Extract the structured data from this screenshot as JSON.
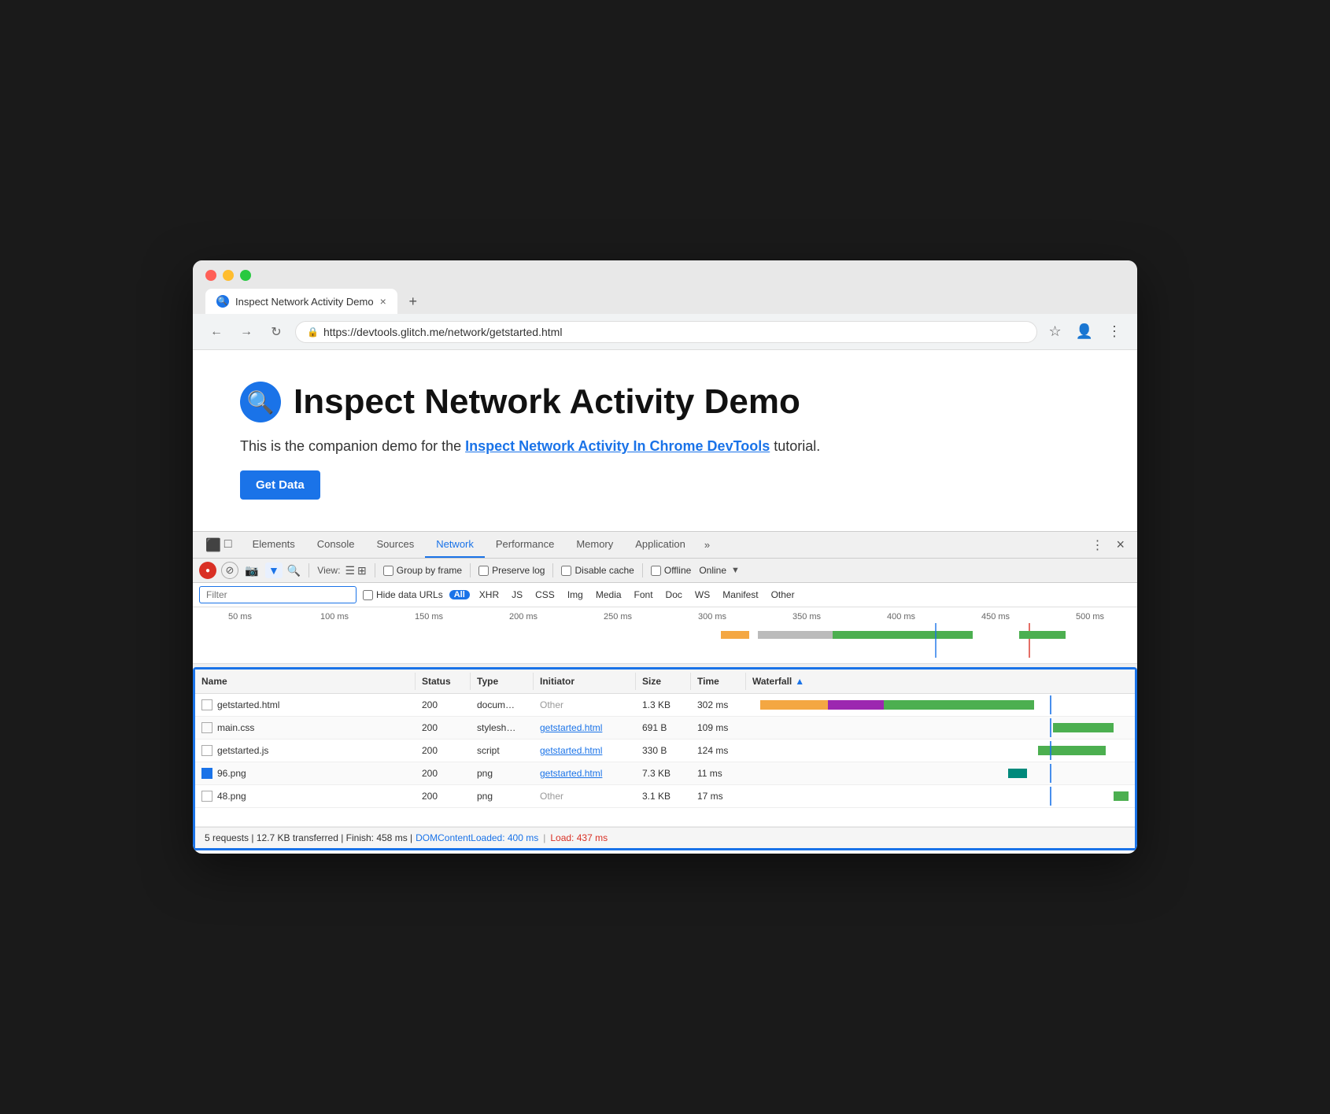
{
  "browser": {
    "tab_title": "Inspect Network Activity Demo",
    "tab_close": "×",
    "tab_new": "+",
    "nav_back": "←",
    "nav_forward": "→",
    "nav_refresh": "↻",
    "address_url": "https://devtools.glitch.me/network/getstarted.html",
    "address_host": "devtools.glitch.me",
    "address_path": "/network/getstarted.html",
    "star_icon": "☆",
    "profile_icon": "👤",
    "menu_icon": "⋮"
  },
  "page": {
    "heading": "Inspect Network Activity Demo",
    "description_prefix": "This is the companion demo for the ",
    "description_link": "Inspect Network Activity In Chrome DevTools",
    "description_suffix": " tutorial.",
    "get_data_btn": "Get Data"
  },
  "devtools": {
    "panel_icons": [
      "⬛",
      "□"
    ],
    "tabs": [
      "Elements",
      "Console",
      "Sources",
      "Network",
      "Performance",
      "Memory",
      "Application"
    ],
    "active_tab": "Network",
    "more_btn": "»",
    "menu_btn": "⋮",
    "close_btn": "×",
    "toolbar": {
      "record_active": true,
      "view_label": "View:",
      "group_by_frame": "Group by frame",
      "preserve_log": "Preserve log",
      "disable_cache": "Disable cache",
      "offline_label": "Offline",
      "online_label": "Online",
      "dropdown": "▼"
    },
    "filter": {
      "placeholder": "Filter",
      "hide_data_urls": "Hide data URLs",
      "all_badge": "All",
      "types": [
        "XHR",
        "JS",
        "CSS",
        "Img",
        "Media",
        "Font",
        "Doc",
        "WS",
        "Manifest",
        "Other"
      ]
    },
    "timeline": {
      "labels": [
        "50 ms",
        "100 ms",
        "150 ms",
        "200 ms",
        "250 ms",
        "300 ms",
        "350 ms",
        "400 ms",
        "450 ms",
        "500 ms"
      ]
    },
    "table": {
      "columns": [
        "Name",
        "Status",
        "Type",
        "Initiator",
        "Size",
        "Time",
        "Waterfall"
      ],
      "sort_col": "Waterfall",
      "rows": [
        {
          "name": "getstarted.html",
          "icon_type": "doc",
          "status": "200",
          "type": "docum…",
          "initiator": "Other",
          "initiator_link": false,
          "size": "1.3 KB",
          "time": "302 ms",
          "wf_orange_start": 2,
          "wf_orange_width": 18,
          "wf_purple_start": 20,
          "wf_purple_width": 15,
          "wf_green_start": 35,
          "wf_green_width": 40
        },
        {
          "name": "main.css",
          "icon_type": "doc",
          "status": "200",
          "type": "stylesh…",
          "initiator": "getstarted.html",
          "initiator_link": true,
          "size": "691 B",
          "time": "109 ms",
          "wf_green_start": 80,
          "wf_green_width": 16
        },
        {
          "name": "getstarted.js",
          "icon_type": "doc",
          "status": "200",
          "type": "script",
          "initiator": "getstarted.html",
          "initiator_link": true,
          "size": "330 B",
          "time": "124 ms",
          "wf_green_start": 76,
          "wf_green_width": 18
        },
        {
          "name": "96.png",
          "icon_type": "img",
          "status": "200",
          "type": "png",
          "initiator": "getstarted.html",
          "initiator_link": true,
          "size": "7.3 KB",
          "time": "11 ms",
          "wf_teal_start": 68,
          "wf_teal_width": 5
        },
        {
          "name": "48.png",
          "icon_type": "doc",
          "status": "200",
          "type": "png",
          "initiator": "Other",
          "initiator_link": false,
          "size": "3.1 KB",
          "time": "17 ms",
          "wf_green_start": 96,
          "wf_green_width": 4
        }
      ]
    },
    "status_bar": {
      "main": "5 requests | 12.7 KB transferred | Finish: 458 ms |",
      "dom_label": "DOMContentLoaded: 400 ms",
      "separator": "|",
      "load_label": "Load: 437 ms"
    }
  }
}
